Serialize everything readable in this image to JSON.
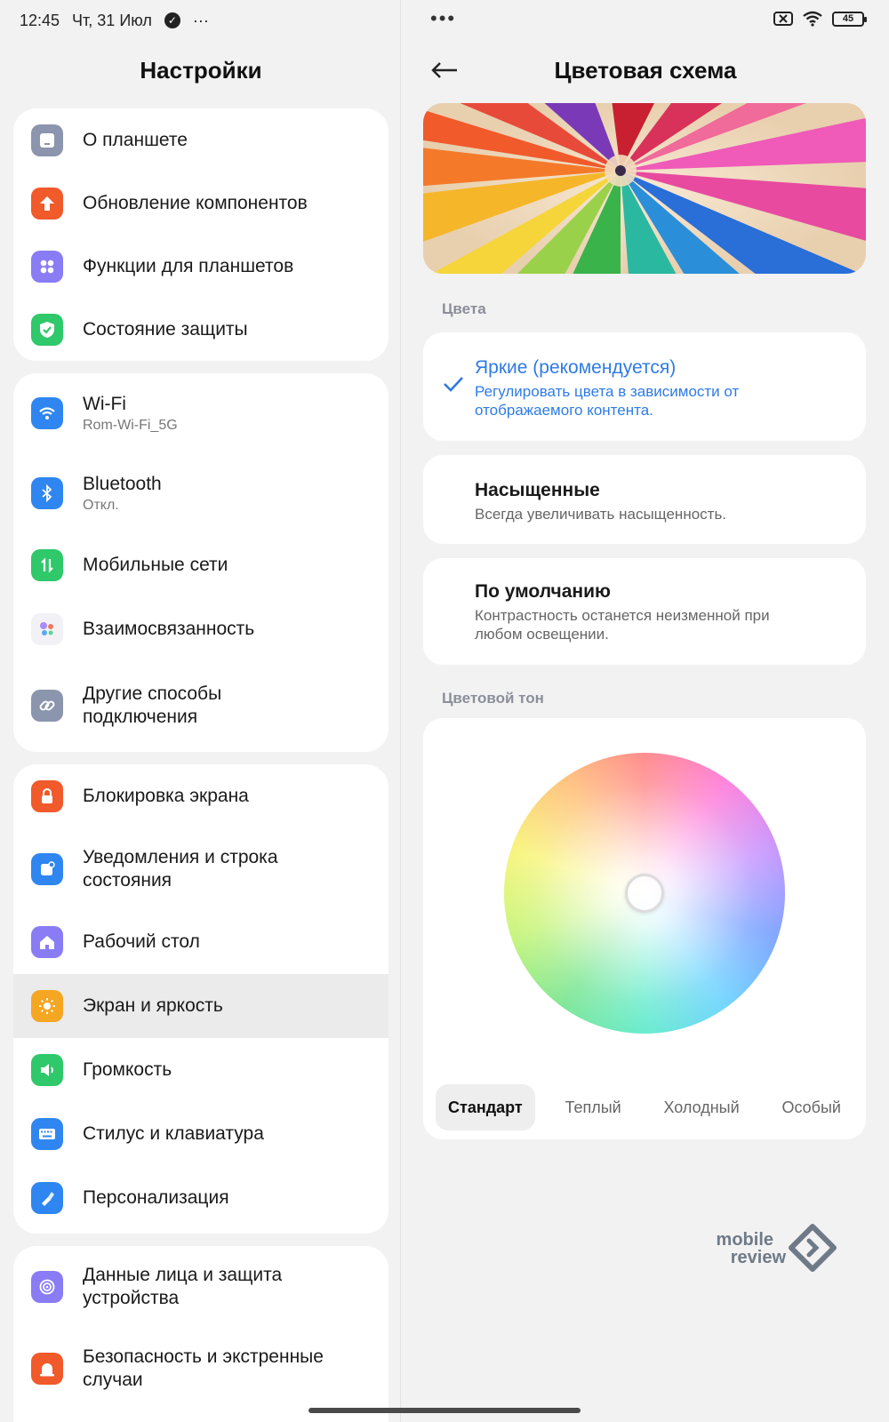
{
  "status": {
    "time": "12:45",
    "date": "Чт, 31 Июл",
    "more": "···",
    "right_dots": "•••",
    "battery": "45"
  },
  "left": {
    "title": "Настройки",
    "groups": [
      {
        "items": [
          {
            "label": "О планшете",
            "icon": "tablet-icon",
            "color": "#8b95ad"
          },
          {
            "label": "Обновление компонентов",
            "icon": "update-arrow-icon",
            "color": "#f15a2b"
          },
          {
            "label": "Функции для планшетов",
            "icon": "grid-icon",
            "color": "#8a7cf5"
          },
          {
            "label": "Состояние защиты",
            "icon": "shield-check-icon",
            "color": "#2fc86a"
          }
        ]
      },
      {
        "items": [
          {
            "label": "Wi-Fi",
            "sub": "Rom-Wi-Fi_5G",
            "icon": "wifi-icon",
            "color": "#2f86f0"
          },
          {
            "label": "Bluetooth",
            "sub": "Откл.",
            "icon": "bluetooth-icon",
            "color": "#2f86f0"
          },
          {
            "label": "Мобильные сети",
            "icon": "mobile-data-icon",
            "color": "#2fc86a"
          },
          {
            "label": "Взаимосвязанность",
            "icon": "interconnect-icon",
            "color": "#f2f2f6"
          },
          {
            "label_lines": [
              "Другие способы",
              "подключения"
            ],
            "icon": "link-icon",
            "color": "#8b95ad"
          }
        ]
      },
      {
        "items": [
          {
            "label": "Блокировка экрана",
            "icon": "lock-icon",
            "color": "#f15a2b"
          },
          {
            "label_lines": [
              "Уведомления и строка",
              "состояния"
            ],
            "icon": "notification-icon",
            "color": "#2f86f0"
          },
          {
            "label": "Рабочий стол",
            "icon": "home-icon",
            "color": "#8a7cf5"
          },
          {
            "label": "Экран и яркость",
            "icon": "sun-icon",
            "color": "#f5a623",
            "active": true
          },
          {
            "label": "Громкость",
            "icon": "speaker-icon",
            "color": "#2fc86a"
          },
          {
            "label": "Стилус и клавиатура",
            "icon": "keyboard-icon",
            "color": "#2f86f0"
          },
          {
            "label": "Персонализация",
            "icon": "brush-icon",
            "color": "#2f86f0"
          }
        ]
      },
      {
        "items": [
          {
            "label_lines": [
              "Данные лица и защита",
              "устройства"
            ],
            "icon": "face-id-icon",
            "color": "#8a7cf5"
          },
          {
            "label_lines": [
              "Безопасность и экстренные",
              "случаи"
            ],
            "icon": "emergency-icon",
            "color": "#f15a2b"
          }
        ]
      }
    ]
  },
  "right": {
    "title": "Цветовая схема",
    "colors_section": "Цвета",
    "options": [
      {
        "title": "Яркие (рекомендуется)",
        "desc_lines": [
          "Регулировать цвета в зависимости от",
          "отображаемого контента."
        ],
        "selected": true
      },
      {
        "title": "Насыщенные",
        "desc_lines": [
          "Всегда увеличивать насыщенность."
        ]
      },
      {
        "title": "По умолчанию",
        "desc_lines": [
          "Контрастность останется неизменной при",
          "любом освещении."
        ]
      }
    ],
    "tone_section": "Цветовой тон",
    "tone_tabs": [
      "Стандарт",
      "Теплый",
      "Холодный",
      "Особый"
    ],
    "tone_selected": "Стандарт",
    "accent": "#2f7be5"
  },
  "watermark": {
    "line1": "mobile",
    "line2": "review"
  }
}
